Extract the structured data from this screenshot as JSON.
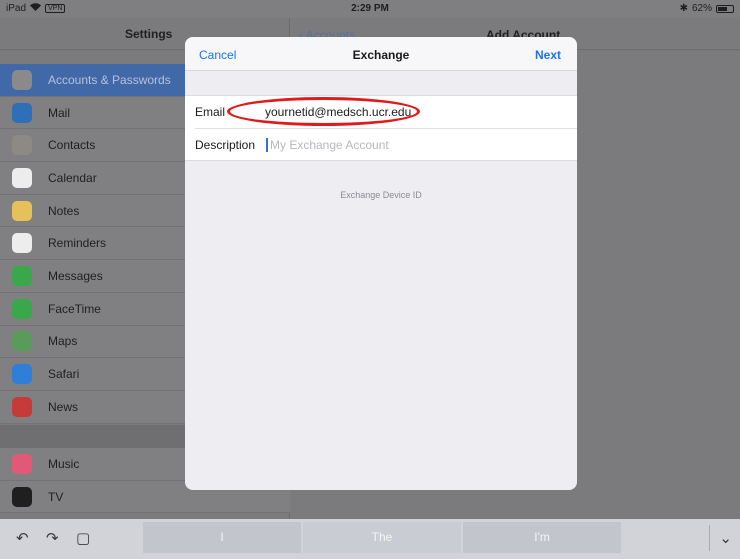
{
  "status": {
    "device": "iPad",
    "time": "2:29 PM",
    "battery": "62%",
    "battery_level": 0.62
  },
  "sidebar": {
    "title": "Settings",
    "group1": [
      {
        "label": "Accounts & Passwords",
        "icon": "key-icon",
        "color": "#8a8a8d",
        "selected": true
      },
      {
        "label": "Mail",
        "icon": "mail-icon",
        "color": "#2f6fb8"
      },
      {
        "label": "Contacts",
        "icon": "contacts-icon",
        "color": "#8d8a85"
      },
      {
        "label": "Calendar",
        "icon": "calendar-icon",
        "color": "#ededed"
      },
      {
        "label": "Notes",
        "icon": "notes-icon",
        "color": "#e6c15a"
      },
      {
        "label": "Reminders",
        "icon": "reminders-icon",
        "color": "#ededed"
      },
      {
        "label": "Messages",
        "icon": "messages-icon",
        "color": "#3aa84a"
      },
      {
        "label": "FaceTime",
        "icon": "facetime-icon",
        "color": "#3aa84a"
      },
      {
        "label": "Maps",
        "icon": "maps-icon",
        "color": "#5a9a5a"
      },
      {
        "label": "Safari",
        "icon": "safari-icon",
        "color": "#2f7fd8"
      },
      {
        "label": "News",
        "icon": "news-icon",
        "color": "#c63a3a"
      }
    ],
    "group2": [
      {
        "label": "Music",
        "icon": "music-icon",
        "color": "#e05a78"
      },
      {
        "label": "TV",
        "icon": "tv-icon",
        "color": "#1f1f1f"
      }
    ]
  },
  "detail": {
    "back_label": "Accounts",
    "title": "Add Account"
  },
  "modal": {
    "cancel": "Cancel",
    "title": "Exchange",
    "next": "Next",
    "email_label": "Email",
    "email_value": "yournetid@medsch.ucr.edu",
    "description_label": "Description",
    "description_placeholder": "My Exchange Account",
    "device_id_label": "Exchange Device ID",
    "highlight_color": "#e01b1b"
  },
  "keyboard": {
    "suggestions": [
      "I",
      "The",
      "I'm"
    ]
  }
}
